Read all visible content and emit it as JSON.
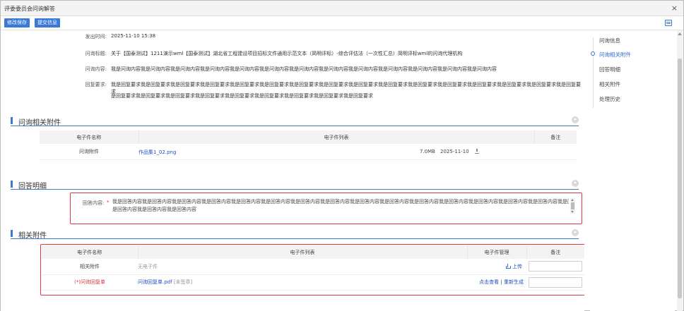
{
  "window": {
    "title": "评委委员会问询解答",
    "close_glyph": "×"
  },
  "toolbar": {
    "save_label": "修改保存",
    "submit_label": "提交信息"
  },
  "info": {
    "send_time_label": "发出时间:",
    "send_time": "2025-11-10 15:38",
    "title_label": "问询标题:",
    "title": "关于【国泰测试】1211演示wml【国泰测试】湖北省工程建设项目招标文件通用示范文本（简明评标）-综合评估法（一次性汇总）简明评标wml的问询代理机构",
    "content_label": "问询内容:",
    "content": "我是问询内容我是问询内容我是问询内容我是问询内容我是问询内容我是问询内容我是问询内容我是问询内容我是问询内容我是问询内容我是问询内容我是问询内容我是问询内容",
    "req_label": "回复要求:",
    "req_line1": "我是回复要求我是回复要求我是回复要求我是回复要求我是回复要求我是回复要求我是回复要求我是回复要求我是回复要求我是回复要求我是回复要求我是回复要求我是回复要求我是回复要求我是回复要求我是回复要求",
    "req_line2": "是回复要求我是回复要求我是回复要求我是回复要求我是回复要求我是回复要求我是回复要求我是回复要求我是回复要求"
  },
  "sec_inquiry_attach": {
    "title": "问询相关附件",
    "col_name": "电子件名称",
    "col_list": "电子件列表",
    "col_remark": "备注",
    "row_name": "问询附件",
    "file_name": "作品集1_02.png",
    "file_size": "7.0MB",
    "file_date": "2025-11-10"
  },
  "sec_answer": {
    "title": "回答明细",
    "label": "回答内容:",
    "required": "*",
    "content_line1": "我是回答内容我是回答内容我是回答内容我是回答内容我是回答内容我是回答内容我是回答内容我是回答内容我是回答内容我是回答内容我是回答内容我是回答内容我是回答内容我是回答内容我是回答内容我是回答内容我是回答内容我是回答内容我是回答内容我是回答内容我是回答内容我是回答内容",
    "content_line2": "是回答内容我是回答内容我是回答内容"
  },
  "sec_related": {
    "title": "相关附件",
    "col_name": "电子件名称",
    "col_list": "电子件列表",
    "col_manage": "电子件管理",
    "col_remark": "备注",
    "row1_name": "相关附件",
    "row1_list": "无电子件",
    "row1_upload": "上传",
    "row2_required": "(*)",
    "row2_name": "问询回复单",
    "row2_file": "问询回复单.pdf",
    "row2_status": "[未签章]",
    "row2_view": "点击查看",
    "row2_sep": "|",
    "row2_regen": "重新生成"
  },
  "sidenav": {
    "items": [
      "问询信息",
      "问询相关附件",
      "回答明细",
      "相关附件",
      "处理历史"
    ],
    "active_index": 1
  },
  "colors": {
    "accent": "#3a79d6",
    "highlight": "#e03a4a",
    "link": "#1f4fc4"
  }
}
